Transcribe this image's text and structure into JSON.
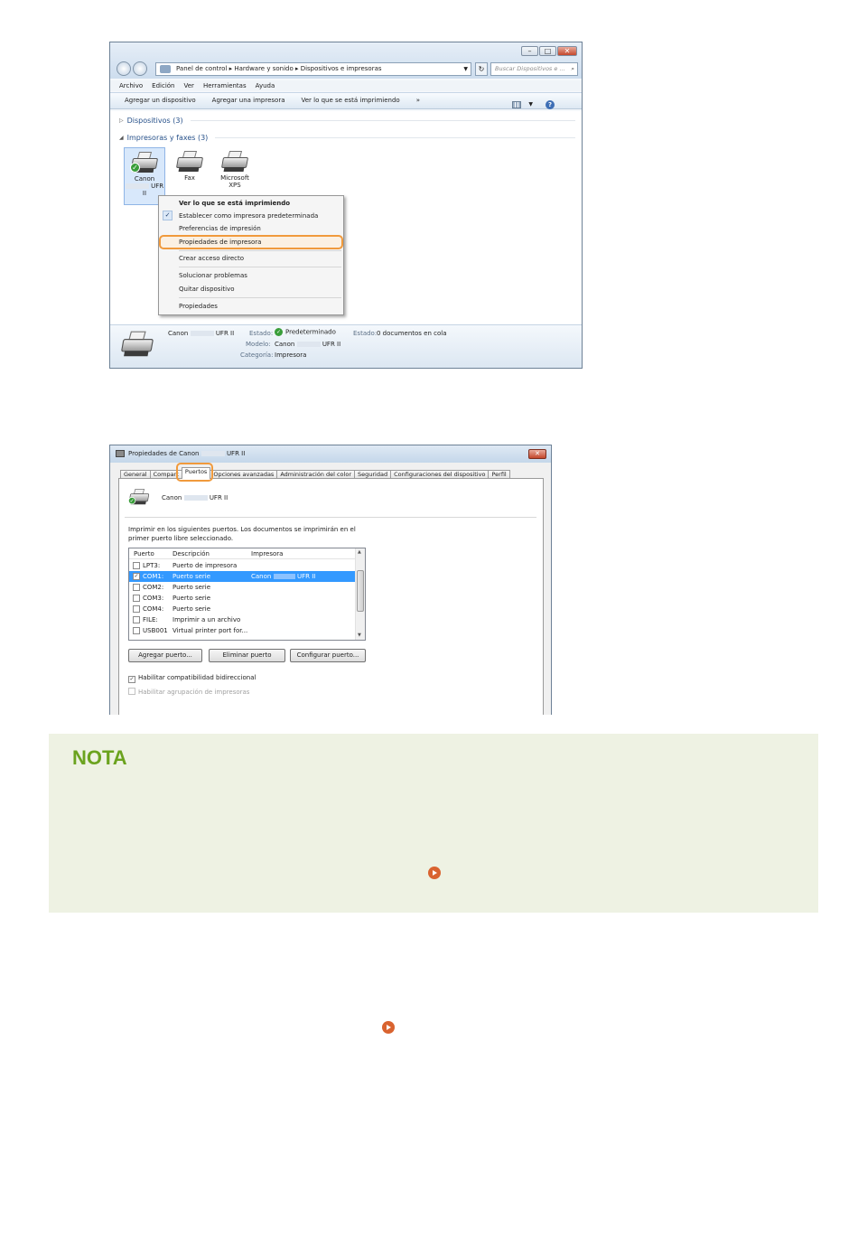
{
  "explorer": {
    "address": "Panel de control  ▸  Hardware y sonido  ▸  Dispositivos e impresoras",
    "search_placeholder": "Buscar Dispositivos e ...",
    "menu": [
      "Archivo",
      "Edición",
      "Ver",
      "Herramientas",
      "Ayuda"
    ],
    "commands": [
      "Agregar un dispositivo",
      "Agregar una impresora",
      "Ver lo que se está imprimiendo",
      "»"
    ],
    "groups": {
      "devices": "Dispositivos (3)",
      "printers": "Impresoras y faxes (3)"
    },
    "printers": [
      {
        "line1": "Canon",
        "line2": "UFR",
        "line3": "II"
      },
      {
        "line1": "Fax",
        "line2": "",
        "line3": ""
      },
      {
        "line1": "Microsoft",
        "line2": "XPS",
        "line3": ""
      }
    ],
    "context_menu": [
      "Ver lo que se está imprimiendo",
      "Establecer como impresora predeterminada",
      "Preferencias de impresión",
      "Propiedades de impresora",
      "Crear acceso directo",
      "Solucionar problemas",
      "Quitar dispositivo",
      "Propiedades"
    ],
    "details": {
      "name_prefix": "Canon",
      "name_suffix": "UFR II",
      "state_label": "Estado:",
      "state_value": "Predeterminado",
      "state2_label": "Estado:",
      "state2_value": "0 documentos en cola",
      "model_label": "Modelo:",
      "model_prefix": "Canon",
      "model_suffix": "UFR II",
      "category_label": "Categoría:",
      "category_value": "Impresora"
    }
  },
  "properties": {
    "title_prefix": "Propiedades de Canon",
    "title_suffix": "UFR II",
    "tabs": [
      "General",
      "Compart",
      "Puertos",
      "Opciones avanzadas",
      "Administración del color",
      "Seguridad",
      "Configuraciones del dispositivo",
      "Perfil"
    ],
    "printer_prefix": "Canon",
    "printer_suffix": "UFR II",
    "description_line1": "Imprimir en los siguientes puertos. Los documentos se imprimirán en el",
    "description_line2": "primer puerto libre seleccionado.",
    "columns": [
      "Puerto",
      "Descripción",
      "Impresora"
    ],
    "ports": [
      {
        "port": "LPT3:",
        "desc": "Puerto de impresora",
        "printer": "",
        "checked": false
      },
      {
        "port": "COM1:",
        "desc": "Puerto serie",
        "printer": "Canon",
        "printer_suffix": "UFR II",
        "checked": true
      },
      {
        "port": "COM2:",
        "desc": "Puerto serie",
        "printer": "",
        "checked": false
      },
      {
        "port": "COM3:",
        "desc": "Puerto serie",
        "printer": "",
        "checked": false
      },
      {
        "port": "COM4:",
        "desc": "Puerto serie",
        "printer": "",
        "checked": false
      },
      {
        "port": "FILE:",
        "desc": "Imprimir a un archivo",
        "printer": "",
        "checked": false
      },
      {
        "port": "USB001",
        "desc": "Virtual printer port for...",
        "printer": "",
        "checked": false
      }
    ],
    "buttons": [
      "Agregar puerto...",
      "Eliminar puerto",
      "Configurar puerto..."
    ],
    "bidi_label": "Habilitar compatibilidad bidireccional",
    "pool_label": "Habilitar agrupación de impresoras"
  },
  "note": {
    "heading": "NOTA"
  }
}
